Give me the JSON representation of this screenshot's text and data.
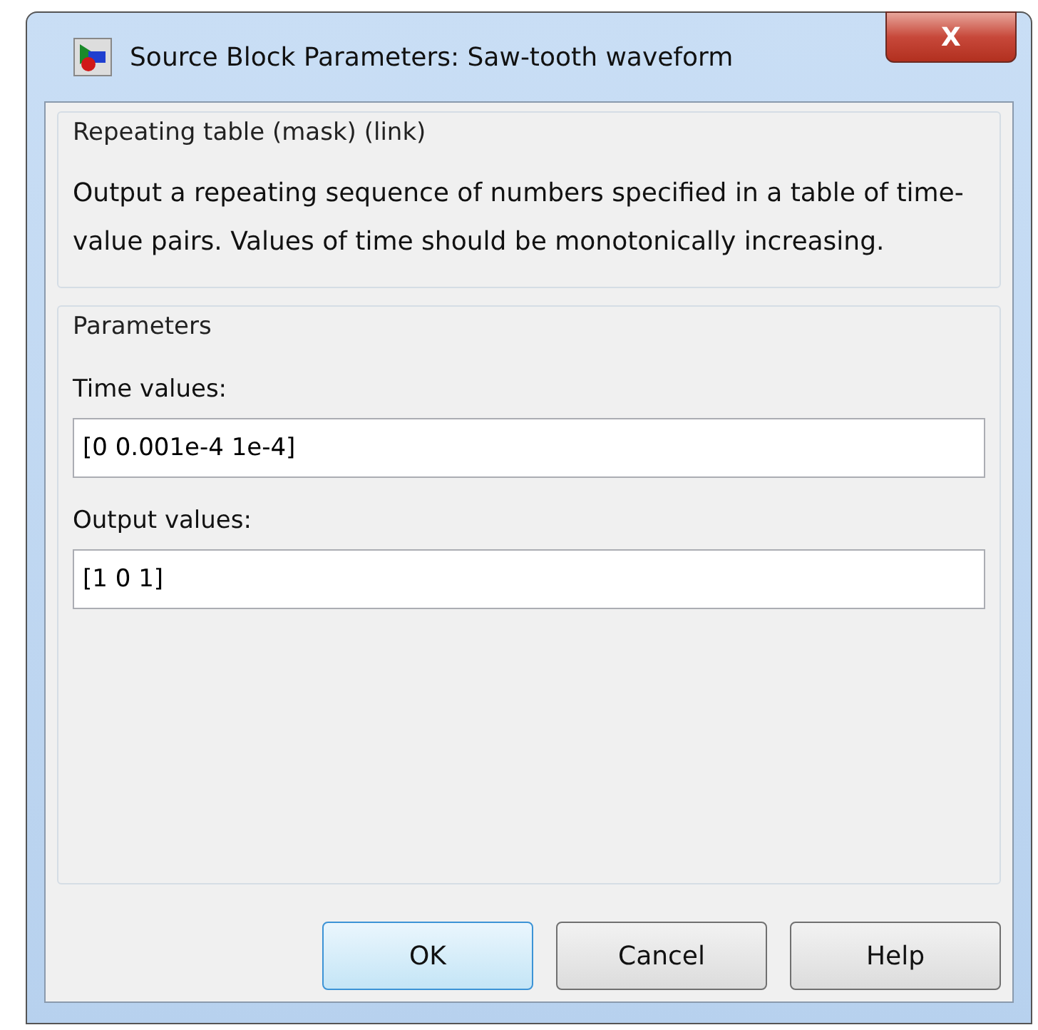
{
  "window": {
    "title": "Source Block Parameters: Saw-tooth waveform",
    "close_label": "X"
  },
  "description_group": {
    "legend": "Repeating table (mask) (link)",
    "text": "Output a repeating sequence of numbers specified in a table of time-value pairs. Values of time should be monotonically increasing."
  },
  "parameters": {
    "legend": "Parameters",
    "fields": [
      {
        "label": "Time values:",
        "value": "[0 0.001e-4 1e-4]"
      },
      {
        "label": "Output values:",
        "value": "[1 0 1]"
      }
    ]
  },
  "buttons": [
    {
      "label": "OK",
      "default": true
    },
    {
      "label": "Cancel",
      "default": false
    },
    {
      "label": "Help",
      "default": false
    }
  ]
}
